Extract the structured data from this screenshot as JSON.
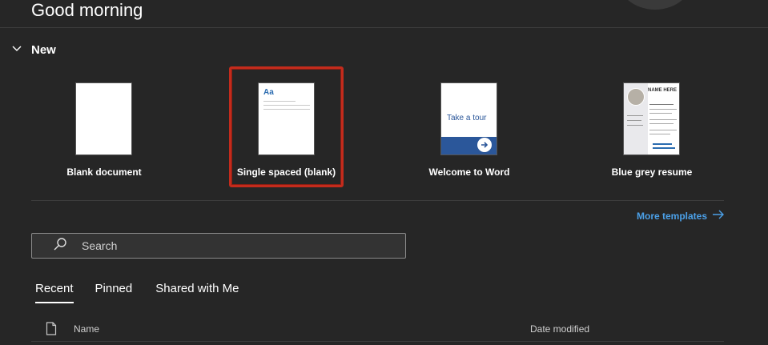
{
  "header": {
    "greeting": "Good morning"
  },
  "new_section": {
    "title": "New",
    "templates": [
      {
        "label": "Blank document"
      },
      {
        "label": "Single spaced (blank)",
        "thumb_text": "Aa",
        "selected": true
      },
      {
        "label": "Welcome to Word",
        "thumb_text": "Take a tour"
      },
      {
        "label": "Blue grey resume",
        "thumb_text": "NAME HERE"
      }
    ],
    "more_templates_label": "More templates"
  },
  "search": {
    "placeholder": "Search"
  },
  "tabs": [
    {
      "label": "Recent",
      "active": true
    },
    {
      "label": "Pinned"
    },
    {
      "label": "Shared with Me"
    }
  ],
  "file_list": {
    "columns": {
      "name": "Name",
      "date_modified": "Date modified"
    }
  },
  "colors": {
    "background": "#262626",
    "accent_link": "#4ba0e8",
    "selection_border": "#c42b1c",
    "word_blue": "#2b579a"
  },
  "icons": [
    "chevron-down-icon",
    "arrow-right-icon",
    "search-icon",
    "file-icon"
  ]
}
